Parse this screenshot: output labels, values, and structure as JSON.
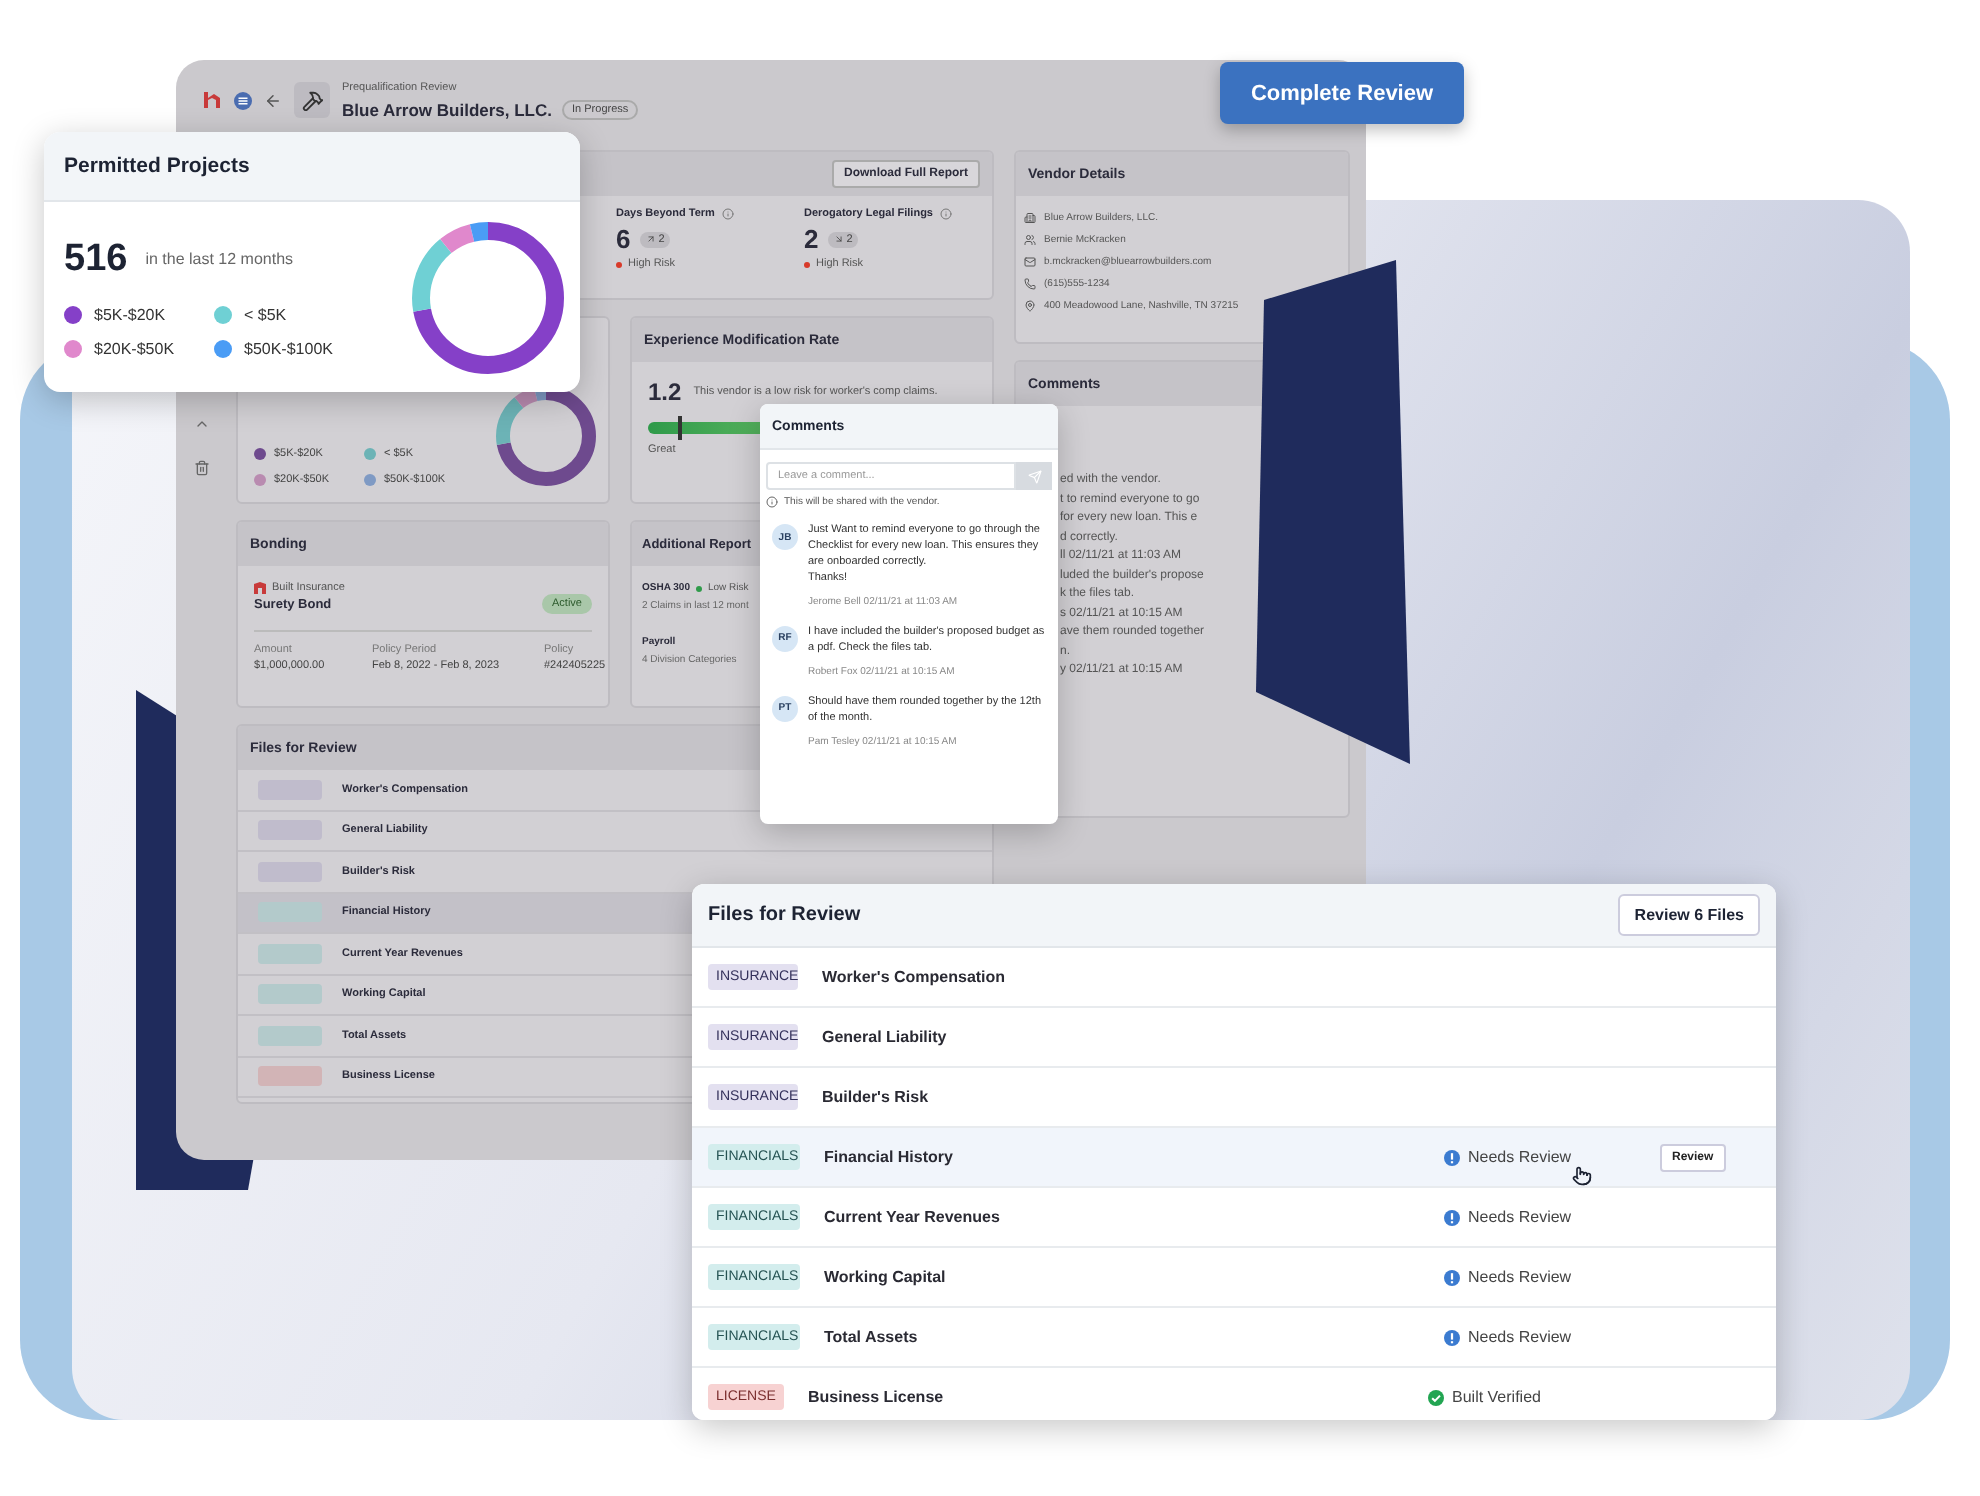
{
  "complete_button": "Complete Review",
  "app": {
    "breadcrumb": "Prequalification Review",
    "title": "Blue Arrow Builders, LLC.",
    "status": "In Progress",
    "report_card": {
      "button": "Download Full Report",
      "metrics": [
        {
          "label": "Days Beyond Term",
          "value": "6",
          "kind": "up",
          "change": "2",
          "risk": "High Risk"
        },
        {
          "label": "Derogatory Legal Filings",
          "value": "2",
          "kind": "down",
          "change": "2",
          "risk": "High Risk"
        }
      ]
    },
    "projects_card": {
      "legend": [
        {
          "label": "$5K-$20K",
          "color": "#6e4a8e"
        },
        {
          "label": "< $5K",
          "color": "#6cb3b6"
        },
        {
          "label": "$20K-$50K",
          "color": "#b98bb0"
        },
        {
          "label": "$50K-$100K",
          "color": "#7f9ac4"
        }
      ]
    },
    "emr": {
      "title": "Experience Modification Rate",
      "value": "1.2",
      "note": "This vendor is a low risk for worker's comp claims.",
      "level": 0.09,
      "rating": "Great"
    },
    "bonding": {
      "title": "Bonding",
      "provider": "Built Insurance",
      "type": "Surety Bond",
      "status": "Active",
      "fields": [
        {
          "label": "Amount",
          "value": "$1,000,000.00"
        },
        {
          "label": "Policy Period",
          "value": "Feb 8, 2022 - Feb 8, 2023"
        },
        {
          "label": "Policy",
          "value": "#242405225"
        }
      ]
    },
    "reports": {
      "title": "Additional Report",
      "items": [
        {
          "name": "OSHA 300",
          "risk": "Low Risk",
          "detail": "2 Claims in last 12 mont"
        },
        {
          "name": "Payroll",
          "detail": "4 Division Categories"
        }
      ]
    },
    "files": {
      "title": "Files for Review",
      "rows": [
        {
          "kind": "insurance",
          "name": "Worker's Compensation",
          "selected": false
        },
        {
          "kind": "insurance",
          "name": "General Liability",
          "selected": false
        },
        {
          "kind": "insurance",
          "name": "Builder's Risk",
          "selected": false
        },
        {
          "kind": "financials",
          "name": "Financial History",
          "selected": true
        },
        {
          "kind": "financials",
          "name": "Current Year Revenues",
          "selected": false
        },
        {
          "kind": "financials",
          "name": "Working Capital",
          "selected": false
        },
        {
          "kind": "financials",
          "name": "Total Assets",
          "selected": false
        },
        {
          "kind": "license",
          "name": "Business License",
          "selected": false
        }
      ]
    },
    "vendor": {
      "title": "Vendor Details",
      "items": [
        {
          "kind": "company",
          "text": "Blue Arrow Builders, LLC."
        },
        {
          "kind": "person",
          "text": "Bernie McKracken"
        },
        {
          "kind": "email",
          "text": "b.mckracken@bluearrowbuilders.com"
        },
        {
          "kind": "phone",
          "text": "(615)555-1234"
        },
        {
          "kind": "location",
          "text": "400 Meadowood Lane, Nashville, TN 37215"
        }
      ]
    },
    "comments": {
      "title": "Comments",
      "fragments": [
        "ed with the vendor.",
        "t to remind everyone to go",
        "for every new loan. This e",
        "d correctly.",
        "ll 02/11/21 at 11:03 AM",
        "luded the builder's propose",
        "k the files tab.",
        "s 02/11/21 at 10:15 AM",
        "ave them rounded together",
        "n.",
        "y 02/11/21 at 10:15 AM"
      ]
    }
  },
  "projects_popup": {
    "title": "Permitted Projects",
    "count": "516",
    "period": "in the last 12 months",
    "legend": [
      {
        "label": "$5K-$20K",
        "color": "#8540c8"
      },
      {
        "label": "< $5K",
        "color": "#6fd0d4"
      },
      {
        "label": "$20K-$50K",
        "color": "#e088cc"
      },
      {
        "label": "$50K-$100K",
        "color": "#4a9cf5"
      }
    ]
  },
  "comments_popup": {
    "title": "Comments",
    "placeholder": "Leave a comment...",
    "notice": "This will be shared with the vendor.",
    "items": [
      {
        "initials": "JB",
        "text": "Just Want to remind everyone to go through the Checklist for every new loan. This ensures they are onboarded correctly.",
        "extra": "Thanks!",
        "meta": "Jerome Bell 02/11/21 at 11:03 AM"
      },
      {
        "initials": "RF",
        "text": "I have included the builder's proposed budget as a pdf. Check the files tab.",
        "meta": "Robert Fox 02/11/21 at 10:15 AM"
      },
      {
        "initials": "PT",
        "text": "Should have them rounded together by the 12th of the month.",
        "meta": "Pam Tesley 02/11/21 at 10:15 AM"
      }
    ]
  },
  "files_popup": {
    "title": "Files for Review",
    "button": "Review 6 Files",
    "rows": [
      {
        "kind": "insurance",
        "tag": "INSURANCE",
        "name": "Worker's Compensation",
        "selected": false
      },
      {
        "kind": "insurance",
        "tag": "INSURANCE",
        "name": "General Liability",
        "selected": false
      },
      {
        "kind": "insurance",
        "tag": "INSURANCE",
        "name": "Builder's Risk",
        "selected": false
      },
      {
        "kind": "financials",
        "tag": "FINANCIALS",
        "name": "Financial History",
        "selected": true,
        "status": {
          "kind": "needs_review",
          "text": "Needs Review"
        },
        "action": "Review"
      },
      {
        "kind": "financials",
        "tag": "FINANCIALS",
        "name": "Current Year Revenues",
        "selected": false,
        "status": {
          "kind": "needs_review",
          "text": "Needs Review"
        }
      },
      {
        "kind": "financials",
        "tag": "FINANCIALS",
        "name": "Working Capital",
        "selected": false,
        "status": {
          "kind": "needs_review",
          "text": "Needs Review"
        }
      },
      {
        "kind": "financials",
        "tag": "FINANCIALS",
        "name": "Total Assets",
        "selected": false,
        "status": {
          "kind": "needs_review",
          "text": "Needs Review"
        }
      },
      {
        "kind": "license",
        "tag": "LICENSE",
        "name": "Business License",
        "selected": false,
        "status": {
          "kind": "verified",
          "text": "Built Verified"
        }
      }
    ]
  }
}
